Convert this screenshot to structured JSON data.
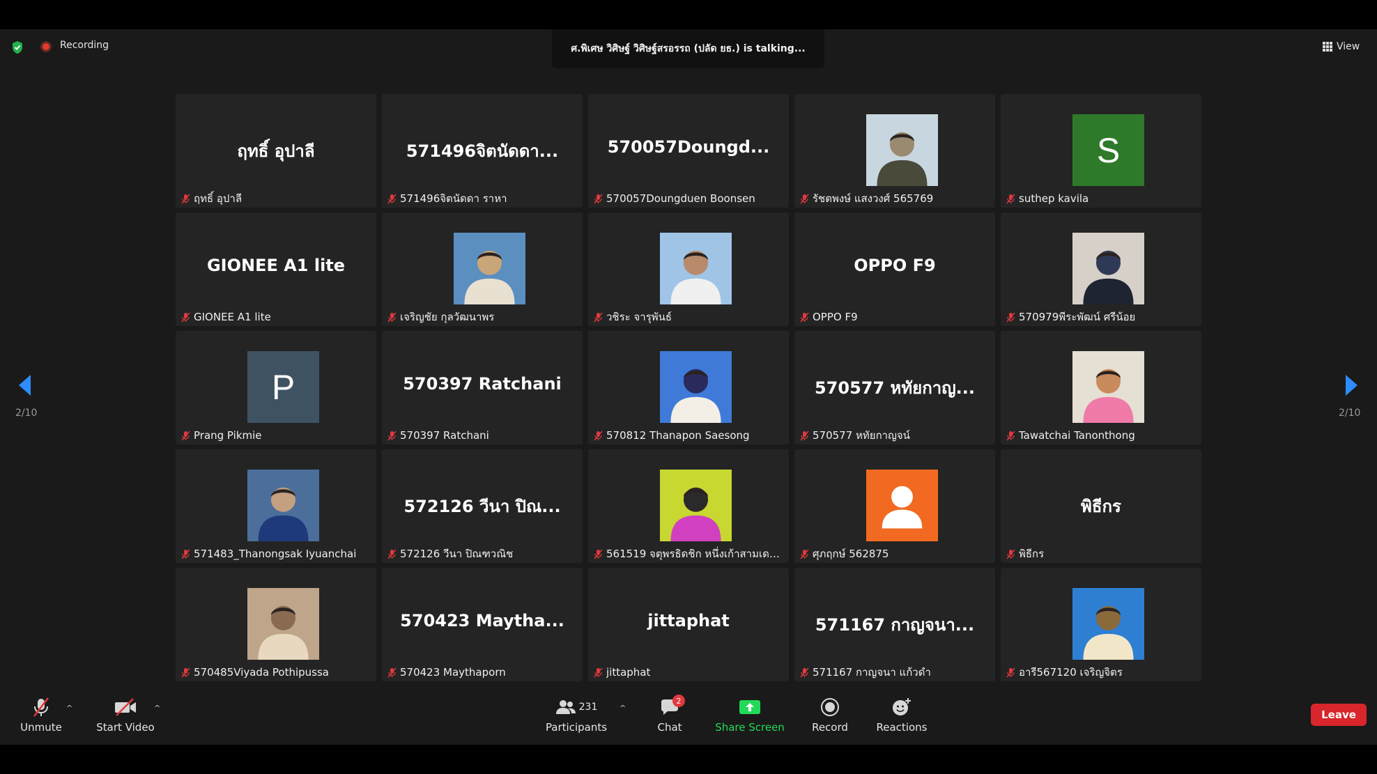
{
  "topbar": {
    "recording_label": "Recording",
    "talking_text": "ศ.พิเศษ วิศิษฐ์ วิศิษฐ์สรอรรถ (ปลัด ยธ.) is  talking...",
    "view_label": "View"
  },
  "pagination": {
    "left": "2/10",
    "right": "2/10"
  },
  "tiles": [
    {
      "display": "ฤทธิ์ อุปาลี",
      "label": "ฤทธิ์ อุปาลี"
    },
    {
      "display": "571496จิตนัดดา...",
      "label": "571496จิตนัดดา ราหา"
    },
    {
      "display": "570057Doungd...",
      "label": "570057Doungduen Boonsen"
    },
    {
      "display": "",
      "label": "รัชตพงษ์ แสงวงศ์ 565769",
      "avatar": "photo"
    },
    {
      "display": "S",
      "label": "suthep kavila",
      "avatar": "letter",
      "color": "#2e7a2a"
    },
    {
      "display": "GIONEE A1 lite",
      "label": "GIONEE A1 lite"
    },
    {
      "display": "",
      "label": "เจริญชัย กุลวัฒนาพร",
      "avatar": "photo"
    },
    {
      "display": "",
      "label": "วชิระ จารุพันธ์",
      "avatar": "photo"
    },
    {
      "display": "OPPO F9",
      "label": "OPPO F9"
    },
    {
      "display": "",
      "label": "570979พีระพัฒน์ ศรีน้อย",
      "avatar": "photo"
    },
    {
      "display": "P",
      "label": "Prang Pikmie",
      "avatar": "letter",
      "color": "#3e5262"
    },
    {
      "display": "570397 Ratchani",
      "label": "570397 Ratchani"
    },
    {
      "display": "",
      "label": "570812 Thanapon Saesong",
      "avatar": "photo"
    },
    {
      "display": "570577 หทัยกาญ...",
      "label": "570577 หทัยกาญจน์"
    },
    {
      "display": "",
      "label": "Tawatchai Tanonthong",
      "avatar": "photo"
    },
    {
      "display": "",
      "label": "571483_Thanongsak Iyuanchai",
      "avatar": "photo"
    },
    {
      "display": "572126 วีนา ปิณ...",
      "label": "572126 วีนา ปิณฑวณิช"
    },
    {
      "display": "",
      "label": "561519 จตุพรธิดชิก หนึ่งเก้าสามเดอร์...",
      "avatar": "photo"
    },
    {
      "display": "",
      "label": "ศุภฤกษ์ 562875",
      "avatar": "default",
      "color": "#f26a21"
    },
    {
      "display": "พิธีกร",
      "label": "พิธีกร"
    },
    {
      "display": "",
      "label": "570485Viyada Pothipussa",
      "avatar": "photo"
    },
    {
      "display": "570423  Maytha...",
      "label": "570423 Maythaporn"
    },
    {
      "display": "jittaphat",
      "label": "jittaphat"
    },
    {
      "display": "571167 กาญจนา...",
      "label": "571167 กาญจนา แก้วดำ"
    },
    {
      "display": "",
      "label": "อารี567120 เจริญจิตร",
      "avatar": "photo"
    }
  ],
  "toolbar": {
    "unmute": "Unmute",
    "start_video": "Start Video",
    "participants": "Participants",
    "participants_count": "231",
    "chat": "Chat",
    "chat_badge": "2",
    "share_screen": "Share Screen",
    "record": "Record",
    "reactions": "Reactions",
    "leave": "Leave"
  },
  "colors": {
    "share_green": "#23d959",
    "leave_red": "#d8262c",
    "arrow_blue": "#2d8cff"
  }
}
